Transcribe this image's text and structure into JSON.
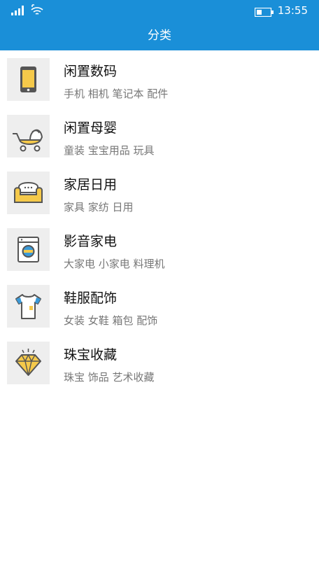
{
  "status_bar": {
    "time": "13:55",
    "signal_icon": "signal-icon",
    "wifi_icon": "wifi-icon",
    "battery_icon": "battery-icon"
  },
  "header": {
    "title": "分类"
  },
  "categories": [
    {
      "title": "闲置数码",
      "subtitle": "手机 相机 笔记本 配件",
      "icon": "phone-icon"
    },
    {
      "title": "闲置母婴",
      "subtitle": "童装 宝宝用品 玩具",
      "icon": "stroller-icon"
    },
    {
      "title": "家居日用",
      "subtitle": "家具 家纺 日用",
      "icon": "sofa-icon"
    },
    {
      "title": "影音家电",
      "subtitle": "大家电 小家电 料理机",
      "icon": "washing-machine-icon"
    },
    {
      "title": "鞋服配饰",
      "subtitle": "女装 女鞋 箱包 配饰",
      "icon": "shirt-icon"
    },
    {
      "title": "珠宝收藏",
      "subtitle": "珠宝 饰品 艺术收藏",
      "icon": "diamond-icon"
    }
  ],
  "colors": {
    "accent": "#1a8fd8",
    "icon_yellow": "#f5c94a",
    "icon_blue": "#3a9ad9",
    "icon_bg": "#eeeeee"
  }
}
